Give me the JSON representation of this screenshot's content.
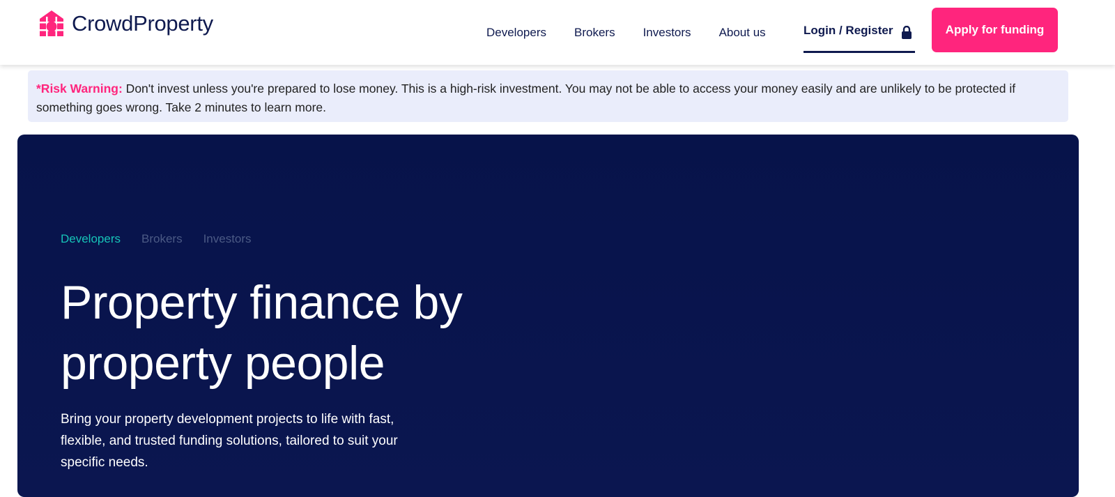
{
  "header": {
    "logo_text": "CrowdProperty",
    "nav": [
      "Developers",
      "Brokers",
      "Investors",
      "About us"
    ],
    "login_label": "Login / Register",
    "apply_label": "Apply for funding"
  },
  "risk_warning": {
    "label": "*Risk Warning:",
    "text": " Don't invest unless you're prepared to lose money. This is a high-risk investment. You may not be able to access your money easily and are unlikely to be protected if something goes wrong. Take 2 minutes to learn more."
  },
  "hero": {
    "tabs": [
      "Developers",
      "Brokers",
      "Investors"
    ],
    "title_line1": "Property finance by",
    "title_line2": "property people",
    "subtitle": "Bring your property development projects to life with fast, flexible, and trusted funding solutions, tailored to suit your specific needs."
  },
  "colors": {
    "brand": "#ff257d",
    "navy": "#0f1a4f",
    "teal": "#16c4b8"
  }
}
